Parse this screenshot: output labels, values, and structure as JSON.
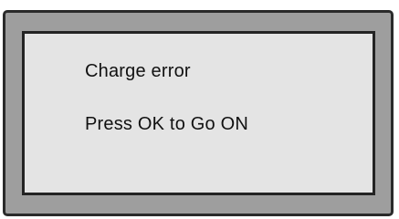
{
  "display": {
    "message_line_1": "Charge error",
    "message_line_2": "Press OK to Go ON"
  },
  "colors": {
    "bezel": "#9e9e9e",
    "screen": "#e4e4e4",
    "border": "#232323",
    "text": "#111111"
  }
}
